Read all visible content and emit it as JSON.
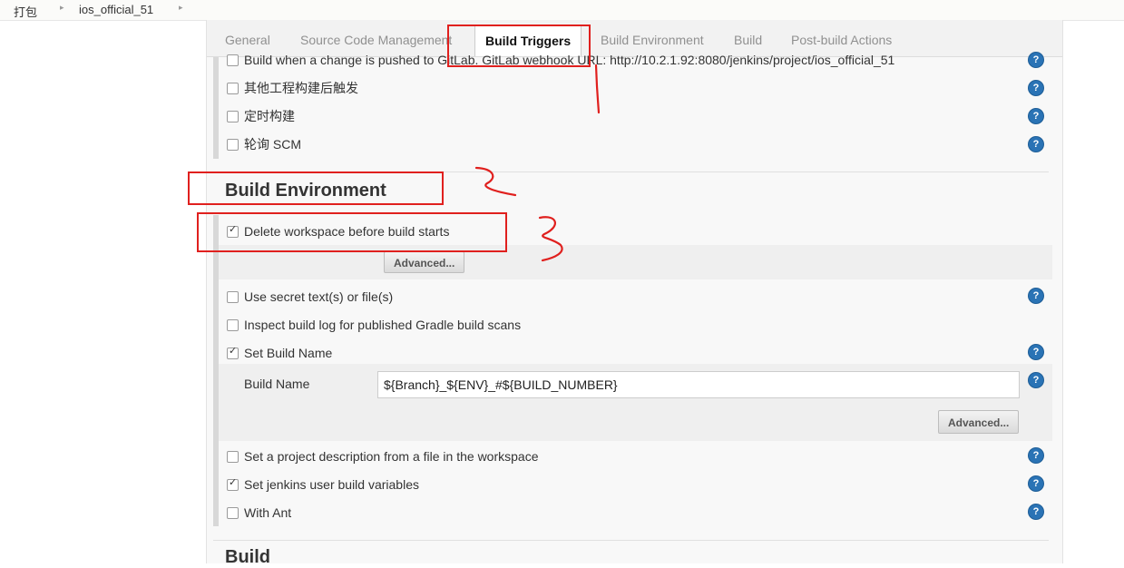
{
  "breadcrumb": {
    "items": [
      "打包",
      "ios_official_51"
    ]
  },
  "tabs": [
    {
      "label": "General"
    },
    {
      "label": "Source Code Management"
    },
    {
      "label": "Build Triggers"
    },
    {
      "label": "Build Environment"
    },
    {
      "label": "Build"
    },
    {
      "label": "Post-build Actions"
    }
  ],
  "triggers": {
    "options": [
      {
        "label": "Build when a change is pushed to GitLab. GitLab webhook URL: http://10.2.1.92:8080/jenkins/project/ios_official_51",
        "checked": false
      },
      {
        "label": "其他工程构建后触发",
        "checked": false
      },
      {
        "label": "定时构建",
        "checked": false
      },
      {
        "label": "轮询 SCM",
        "checked": false
      }
    ]
  },
  "build_environment": {
    "title": "Build Environment",
    "delete_workspace": {
      "label": "Delete workspace before build starts",
      "checked": true
    },
    "advanced_label": "Advanced...",
    "options": [
      {
        "label": "Use secret text(s) or file(s)",
        "checked": false
      },
      {
        "label": "Inspect build log for published Gradle build scans",
        "checked": false
      },
      {
        "label": "Set Build Name",
        "checked": true
      }
    ],
    "build_name": {
      "label": "Build Name",
      "value": "${Branch}_${ENV}_#${BUILD_NUMBER}",
      "advanced_label": "Advanced..."
    },
    "more_options": [
      {
        "label": "Set a project description from a file in the workspace",
        "checked": false
      },
      {
        "label": "Set jenkins user build variables",
        "checked": true
      },
      {
        "label": "With Ant",
        "checked": false
      }
    ]
  },
  "build": {
    "title": "Build"
  },
  "help_icon_glyph": "?",
  "annotation_color": "#e0201e"
}
